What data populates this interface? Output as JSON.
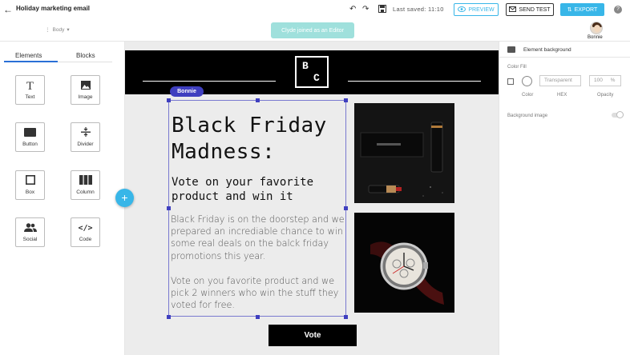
{
  "topbar": {
    "back_icon": "arrow-left-icon",
    "title": "Holiday marketing email",
    "undo_icon": "undo-icon",
    "redo_icon": "redo-icon",
    "save_icon": "floppy-disk-icon",
    "saved_text": "Last saved: 11:10",
    "preview_label": "PREVIEW",
    "send_test_label": "SEND TEST",
    "export_label": "EXPORT",
    "help_icon": "help-icon",
    "accent_color": "#38b6e8"
  },
  "subbar": {
    "body_selector": "Body",
    "banner_text": "Clyde joined as an Editor",
    "collaborator_name": "Bonnie"
  },
  "left_panel": {
    "tabs": [
      "Elements",
      "Blocks"
    ],
    "active_tab": "Elements",
    "tiles": [
      {
        "label": "Text",
        "icon": "text-icon"
      },
      {
        "label": "Image",
        "icon": "image-icon"
      },
      {
        "label": "Button",
        "icon": "button-icon"
      },
      {
        "label": "Divider",
        "icon": "divider-icon"
      },
      {
        "label": "Box",
        "icon": "box-icon"
      },
      {
        "label": "Column",
        "icon": "column-icon"
      },
      {
        "label": "Social",
        "icon": "social-icon"
      },
      {
        "label": "Code",
        "icon": "code-icon"
      }
    ],
    "add_button": "+"
  },
  "email": {
    "logo_letters": [
      "B",
      "C"
    ],
    "editing_user": "Bonnie",
    "heading": "Black Friday Madness:",
    "subheading": "Vote on your favorite product and win it",
    "paragraph_1": "Black Friday is on the doorstep and we prepared an incrediable chance to win some real deals on the balck friday promotions this year.",
    "paragraph_2": "Vote on you favorite product and we pick 2 winners who win the stuff they voted for free.",
    "product_images": [
      "cosmetics-product-photo",
      "wristwatch-product-photo"
    ],
    "vote_button": "Vote"
  },
  "right_panel": {
    "title": "Element background",
    "color_fill_label": "Color Fill",
    "hex_value": "Transparent",
    "opacity_value": "100",
    "opacity_unit": "%",
    "color_caption": "Color",
    "hex_caption": "HEX",
    "opacity_caption": "Opacity",
    "background_image_label": "Background image"
  }
}
